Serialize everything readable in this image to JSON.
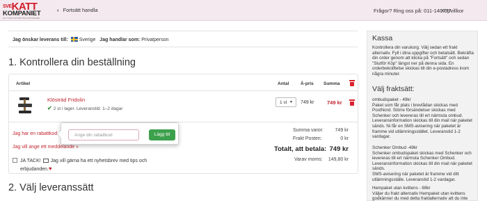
{
  "header": {
    "logo_top": "KATT",
    "logo_top_prefix": "SVE",
    "logo_bottom": "KOMPANIET",
    "logo_tagline": "ALLT FÖR KATTER OCH KATTÄGARE",
    "back_label": "Fortsätt handla",
    "phone_text": "Frågor? Ring oss på: 011-140777",
    "terms_link": "Köpvillkor"
  },
  "delivery": {
    "country_label": "Jag önskar leverans till:",
    "country_value": "Sverige",
    "customer_label": "Jag handlar som:",
    "customer_value": "Privatperson"
  },
  "section1": {
    "title": "1. Kontrollera din beställning"
  },
  "section2": {
    "title": "2. Välj leveranssätt"
  },
  "table": {
    "col_article": "Artikel",
    "col_qty": "Antal",
    "col_unit_price": "À-pris",
    "col_sum": "Summa"
  },
  "item": {
    "name": "Klösträd Fridolin",
    "stock": "2 st i lager. Leveranstid: 1–2 dagar",
    "qty": "1 st",
    "unit_price": "749 kr",
    "sum": "749 kr"
  },
  "links": {
    "coupon": "Jag har en rabattkod »",
    "message": "Jag vill ange ett meddelande »"
  },
  "newsletter": {
    "line1": "JA TACK!",
    "line1_rest": "Jag vill gärna ha ett nyhetsbrev med tips och",
    "line2": "erbjudanden."
  },
  "coupon_popover": {
    "placeholder": "Ange din rabattkod",
    "apply_label": "Lägg till"
  },
  "totals": {
    "subtotal_label": "Summa varor:",
    "subtotal_value": "749 kr",
    "shipping_label": "Frakt Posten:",
    "shipping_value": "0 kr",
    "total_label": "Totalt, att betala:",
    "total_value": "749 kr",
    "vat_label": "Varav moms:",
    "vat_value": "149,80 kr"
  },
  "sidebar": {
    "title": "Kassa",
    "intro": "Kontrollera din varukorg. Välj sedan ett frakt alternativ. Fyll i dina uppgifter och betalsätt. Bekräfta din order genom att klicka på \"Fortsätt\" och sedan \"Slutför Köp\" längst ner på denna sida. En orderbekräftelse skickas till din e-postadress inom några minuter.",
    "shipping_title": "Välj fraktsätt:",
    "shipping_options": [
      {
        "text": "ombudspaket - 49kr\nPaket som får plats i brevlådan skickas med PostNord. Större försändelser skickas med Schenker och levereras till ert närmsta ombud. Leveransinformation skickas till din mail när paketet sänds. Ni får en SMS-avisering när paketet är framme vid utlämningsstället. Leveranstid 1-2 vardagar."
      },
      {
        "text": "Schenker Ombud -49kr\nSchenker ombudspaket skickas med Schenker och levereras till ert närmsta Schenker Ombud. Leveransinformation skickas till din mail när paketet sänds.\nSMS-avisering när paketet är framme vid ditt utlämningsställe. Leveranstid 1-2 vardagar."
      },
      {
        "text": "Hempaket utan kvittens - 69kr\nVäljer du frakt alternativ Hempaket utan kvittens godkänner du med detta fraktalternativ att du inte kvitterar"
      }
    ]
  },
  "colors": {
    "brand_red": "#c0262f",
    "header_bg": "#f4e9ee",
    "button_green": "#3da04c"
  }
}
